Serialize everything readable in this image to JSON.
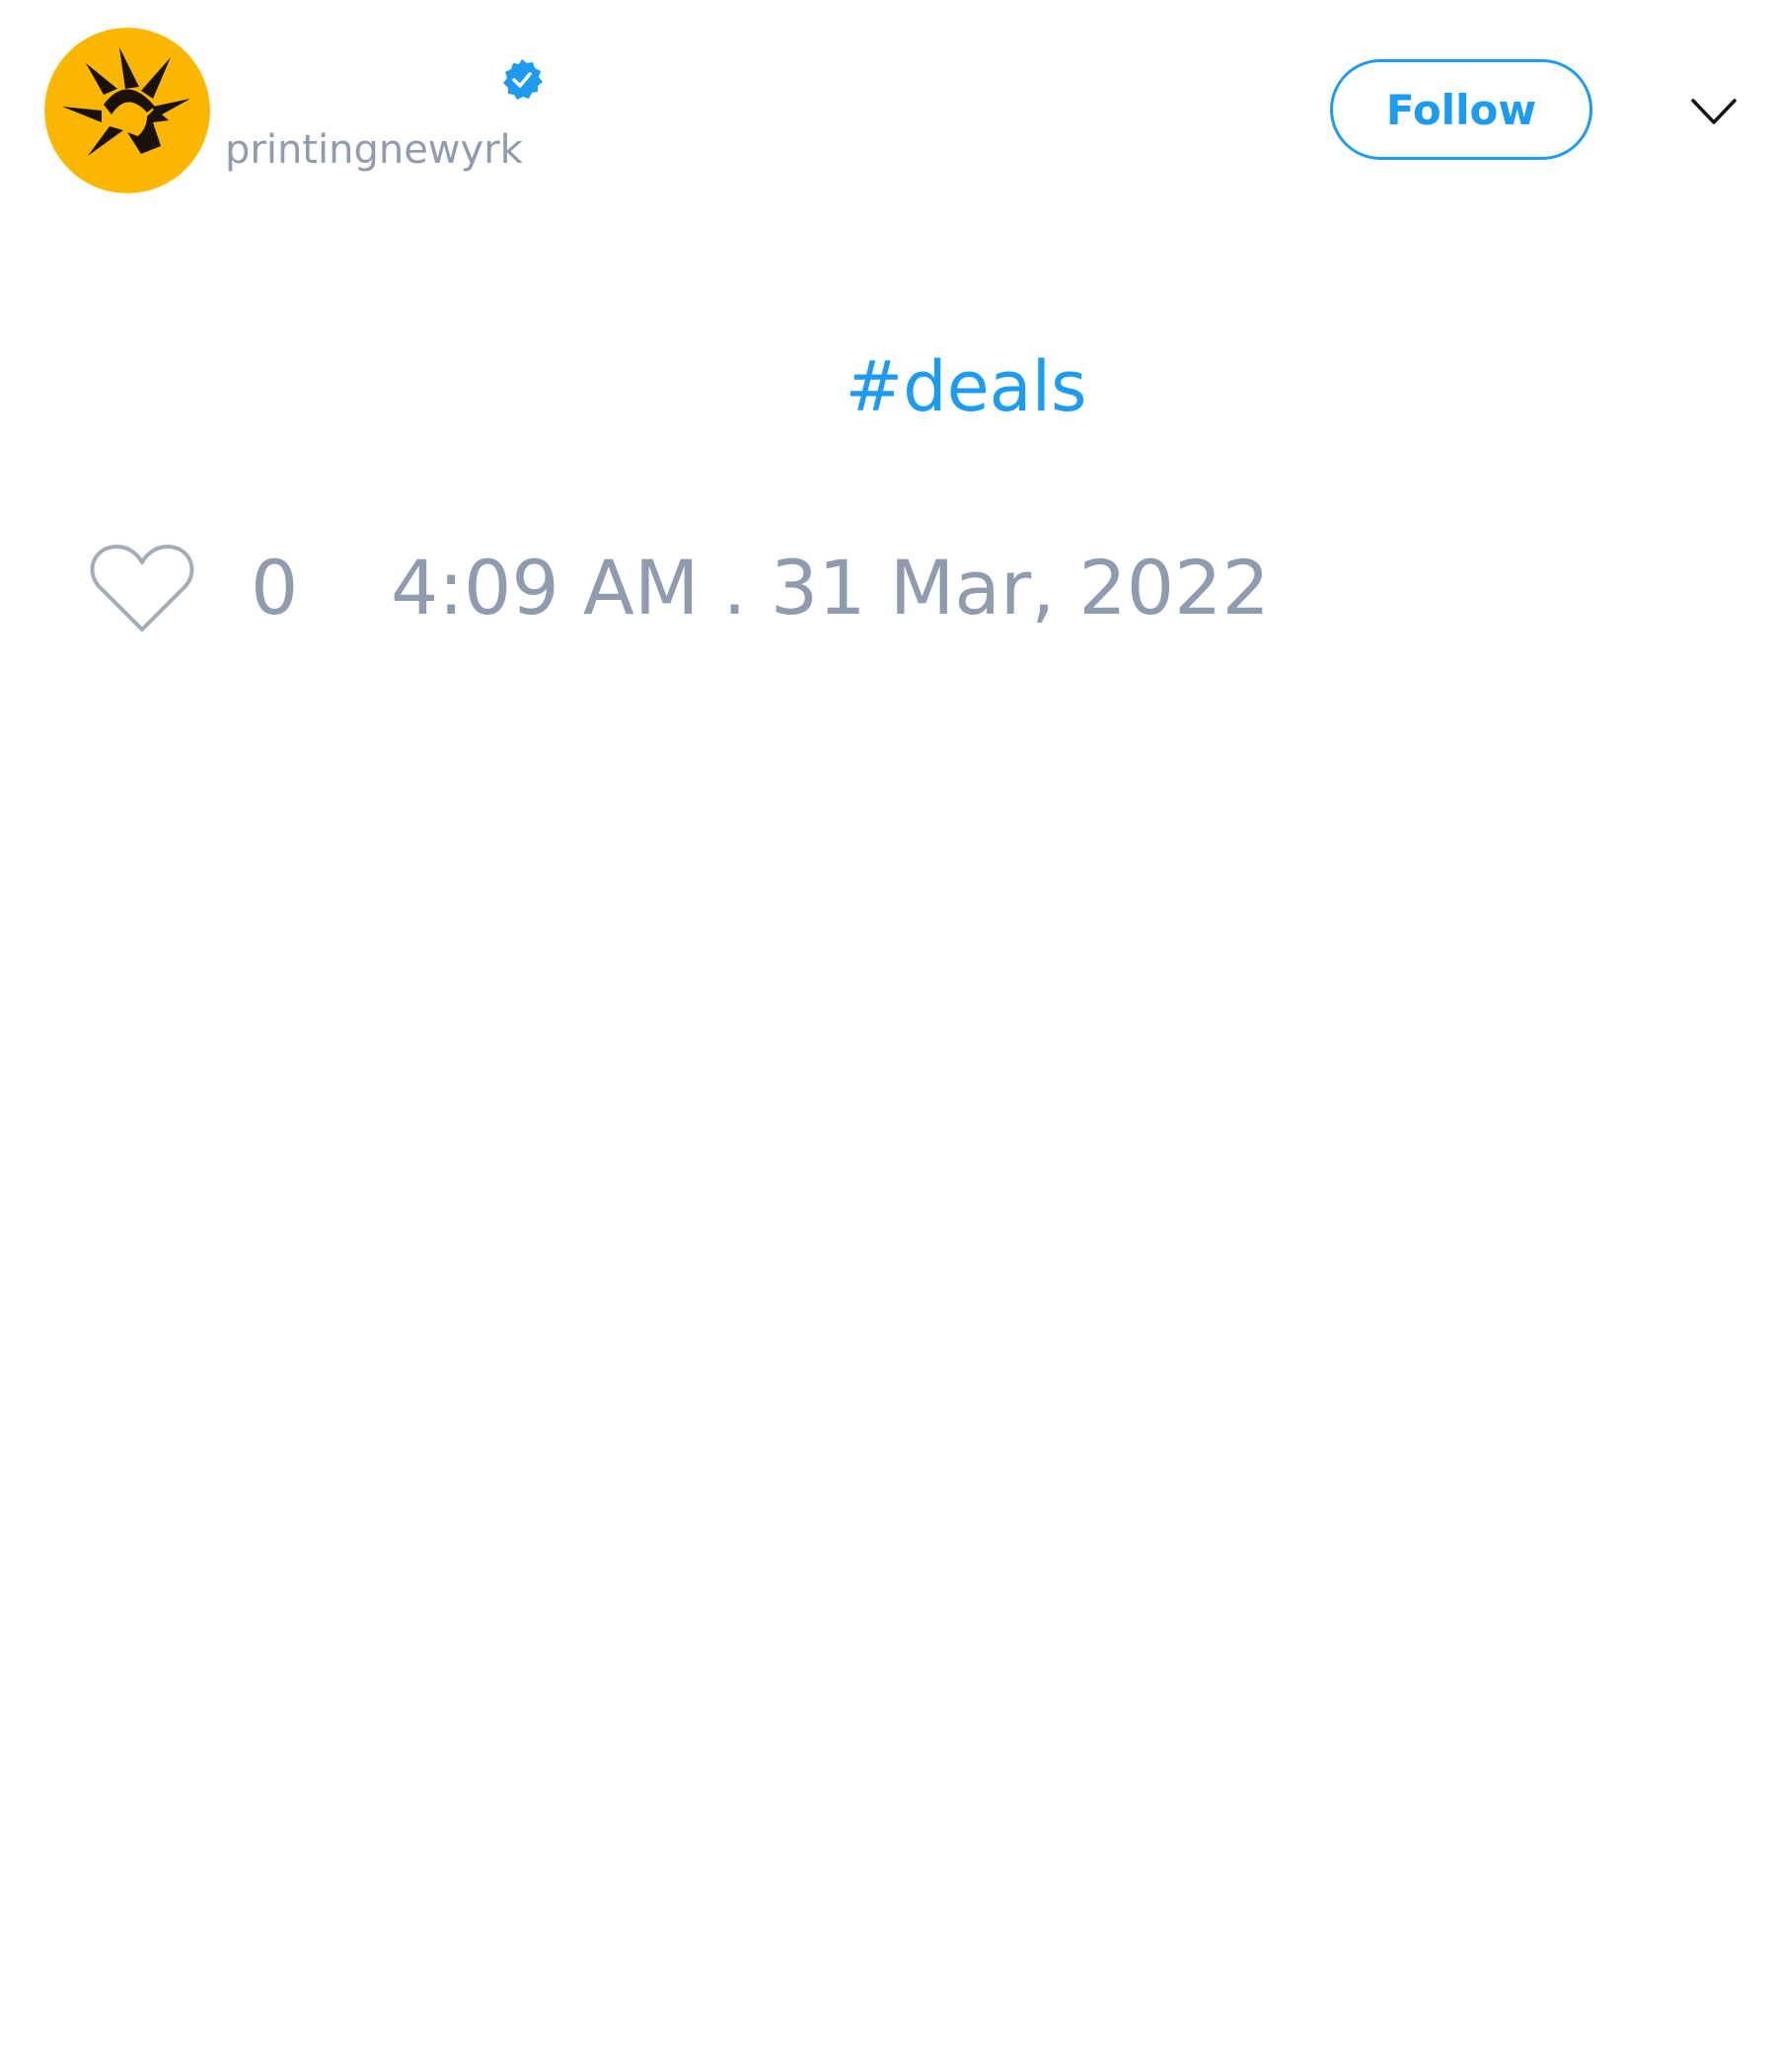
{
  "account": {
    "handle": "printingnewyrk",
    "verified": true,
    "avatar_icon": "sunburst-logo-icon",
    "avatar_color": "#fbb700"
  },
  "actions": {
    "follow_label": "Follow",
    "menu_icon": "chevron-down-icon"
  },
  "tweet": {
    "hashtag": "#deals"
  },
  "footer": {
    "like_count": "0",
    "timestamp": "4:09 AM . 31 Mar, 2022"
  },
  "colors": {
    "accent": "#1d9bf0",
    "muted_text": "#8f9cb0",
    "background": "#ffffff"
  }
}
